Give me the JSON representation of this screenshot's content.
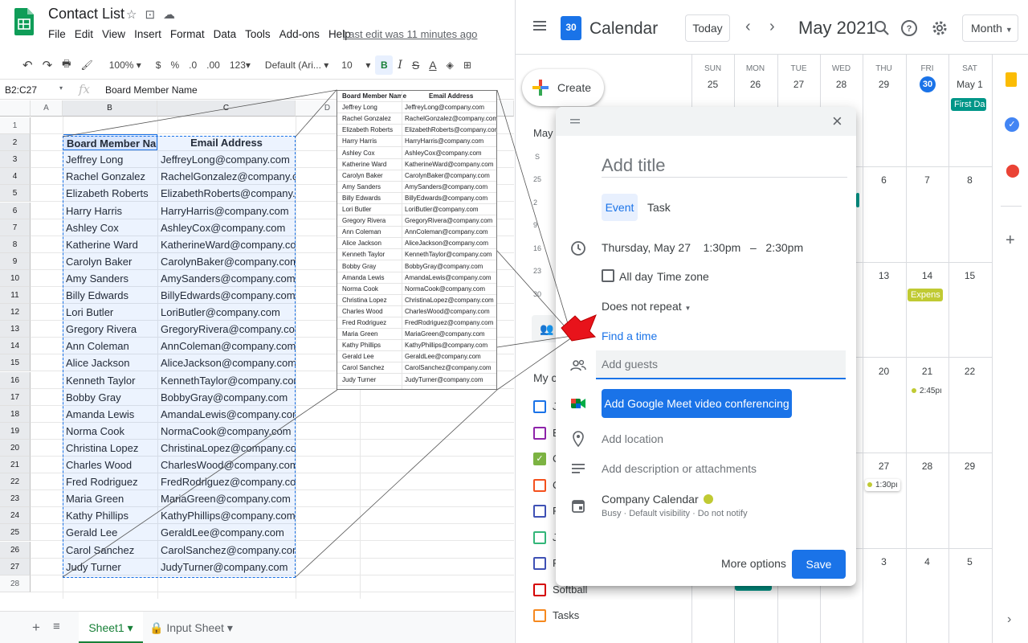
{
  "sheets": {
    "title": "Contact List",
    "menu": [
      "File",
      "Edit",
      "View",
      "Insert",
      "Format",
      "Data",
      "Tools",
      "Add-ons",
      "Help"
    ],
    "last_edit": "Last edit was 11 minutes ago",
    "toolbar": {
      "zoom": "100%",
      "currency": "$",
      "percent": "%",
      "dec_decrease": ".0",
      "dec_increase": ".00",
      "format_more": "123",
      "font": "Default (Ari...",
      "font_size": "10",
      "bold": "B",
      "italic": "I",
      "strike": "S",
      "text_color": "A"
    },
    "name_box": "B2:C27",
    "fx": "fx",
    "formula_value": "Board Member Name",
    "columns": [
      "A",
      "B",
      "C",
      "D"
    ],
    "rows": [
      "1",
      "2",
      "3",
      "4",
      "5",
      "6",
      "7",
      "8",
      "9",
      "10",
      "11",
      "12",
      "13",
      "14",
      "15",
      "16",
      "17",
      "18",
      "19",
      "20",
      "21",
      "22",
      "23",
      "24",
      "25",
      "26",
      "27",
      "28"
    ],
    "header": {
      "name": "Board Member Name",
      "email": "Email Address"
    },
    "contacts": [
      {
        "name": "Jeffrey Long",
        "email": "JeffreyLong@company.com"
      },
      {
        "name": "Rachel Gonzalez",
        "email": "RachelGonzalez@company.com"
      },
      {
        "name": "Elizabeth Roberts",
        "email": "ElizabethRoberts@company.com"
      },
      {
        "name": "Harry Harris",
        "email": "HarryHarris@company.com"
      },
      {
        "name": "Ashley Cox",
        "email": "AshleyCox@company.com"
      },
      {
        "name": "Katherine Ward",
        "email": "KatherineWard@company.com"
      },
      {
        "name": "Carolyn Baker",
        "email": "CarolynBaker@company.com"
      },
      {
        "name": "Amy Sanders",
        "email": "AmySanders@company.com"
      },
      {
        "name": "Billy Edwards",
        "email": "BillyEdwards@company.com"
      },
      {
        "name": "Lori Butler",
        "email": "LoriButler@company.com"
      },
      {
        "name": "Gregory Rivera",
        "email": "GregoryRivera@company.com"
      },
      {
        "name": "Ann Coleman",
        "email": "AnnColeman@company.com"
      },
      {
        "name": "Alice Jackson",
        "email": "AliceJackson@company.com"
      },
      {
        "name": "Kenneth Taylor",
        "email": "KennethTaylor@company.com"
      },
      {
        "name": "Bobby Gray",
        "email": "BobbyGray@company.com"
      },
      {
        "name": "Amanda Lewis",
        "email": "AmandaLewis@company.com"
      },
      {
        "name": "Norma Cook",
        "email": "NormaCook@company.com"
      },
      {
        "name": "Christina Lopez",
        "email": "ChristinaLopez@company.com"
      },
      {
        "name": "Charles Wood",
        "email": "CharlesWood@company.com"
      },
      {
        "name": "Fred Rodriguez",
        "email": "FredRodriguez@company.com"
      },
      {
        "name": "Maria Green",
        "email": "MariaGreen@company.com"
      },
      {
        "name": "Kathy Phillips",
        "email": "KathyPhillips@company.com"
      },
      {
        "name": "Gerald Lee",
        "email": "GeraldLee@company.com"
      },
      {
        "name": "Carol Sanchez",
        "email": "CarolSanchez@company.com"
      },
      {
        "name": "Judy Turner",
        "email": "JudyTurner@company.com"
      }
    ],
    "tabs": {
      "active": "Sheet1",
      "other": "Input Sheet"
    }
  },
  "calendar": {
    "app_name": "Calendar",
    "logo_day": "30",
    "today": "Today",
    "prev": "‹",
    "next": "›",
    "month_label": "May 2021",
    "view": "Month",
    "create": "Create",
    "mini_title": "May 2",
    "mini_cols": [
      "S",
      "M"
    ],
    "mini_rows": [
      [
        "25",
        "2"
      ],
      [
        "2",
        ""
      ],
      [
        "9",
        "1"
      ],
      [
        "16",
        "1"
      ],
      [
        "23",
        "2"
      ],
      [
        "30",
        "3"
      ]
    ],
    "my_calendars": "My ca",
    "cal_list": [
      {
        "label": "J",
        "color": "#1a73e8",
        "checked": false
      },
      {
        "label": "B",
        "color": "#8e24aa",
        "checked": false
      },
      {
        "label": "C",
        "color": "#7cb342",
        "checked": true
      },
      {
        "label": "C",
        "color": "#f4511e",
        "checked": false
      },
      {
        "label": "F",
        "color": "#3f51b5",
        "checked": false
      },
      {
        "label": "J",
        "color": "#33b679",
        "checked": false
      },
      {
        "label": "R",
        "color": "#3f51b5",
        "checked": false
      },
      {
        "label": "Softball",
        "color": "#d50000",
        "checked": false
      },
      {
        "label": "Tasks",
        "color": "#f6891f",
        "checked": false
      }
    ],
    "day_names": [
      "SUN",
      "MON",
      "TUE",
      "WED",
      "THU",
      "FRI",
      "SAT"
    ],
    "week1": [
      "25",
      "26",
      "27",
      "28",
      "29",
      "30",
      "May 1"
    ],
    "week2_visible": [
      "6",
      "7",
      "8"
    ],
    "week3_visible": [
      "13",
      "14",
      "15"
    ],
    "week4_visible": [
      "20",
      "21",
      "22"
    ],
    "week5_visible": [
      "27",
      "28",
      "29"
    ],
    "week6_visible": [
      "3",
      "4",
      "5"
    ],
    "events": {
      "first_day": "First Da",
      "expense": "Expens",
      "time_245": "2:45pı",
      "time_130": "1:30pı"
    },
    "colors": {
      "accent": "#1a73e8",
      "event_teal": "#009688",
      "event_lime": "#c0ca33"
    }
  },
  "dialog": {
    "title_placeholder": "Add title",
    "tab_event": "Event",
    "tab_task": "Task",
    "date": "Thursday, May 27",
    "start_time": "1:30pm",
    "dash": "–",
    "end_time": "2:30pm",
    "all_day": "All day",
    "time_zone": "Time zone",
    "repeat": "Does not repeat",
    "find_time": "Find a time",
    "guests_placeholder": "Add guests",
    "meet": "Add Google Meet video conferencing",
    "location": "Add location",
    "description": "Add description or attachments",
    "calendar_name": "Company Calendar",
    "calendar_sub": "Busy · Default visibility · Do not notify",
    "more_options": "More options",
    "save": "Save"
  },
  "zoom_panel": {
    "header": {
      "name": "Board Member Name",
      "email": "Email Address"
    }
  }
}
